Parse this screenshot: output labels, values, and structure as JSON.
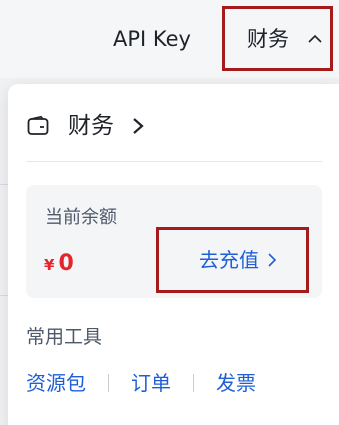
{
  "topbar": {
    "api_key_label": "API Key",
    "finance_label": "财务",
    "finance_icon": "chevron-up-icon"
  },
  "dropdown": {
    "header": {
      "icon": "wallet-icon",
      "title": "财务",
      "arrow_icon": "chevron-right-icon"
    },
    "balance": {
      "label": "当前余额",
      "currency": "¥",
      "amount": "0",
      "recharge_label": "去充值",
      "recharge_icon": "chevron-right-icon"
    },
    "tools": {
      "label": "常用工具",
      "links": [
        "资源包",
        "订单",
        "发票"
      ]
    }
  },
  "colors": {
    "accent_link": "#1f5fd6",
    "amount_red": "#e4262b",
    "highlight_border": "#a51b1b"
  }
}
